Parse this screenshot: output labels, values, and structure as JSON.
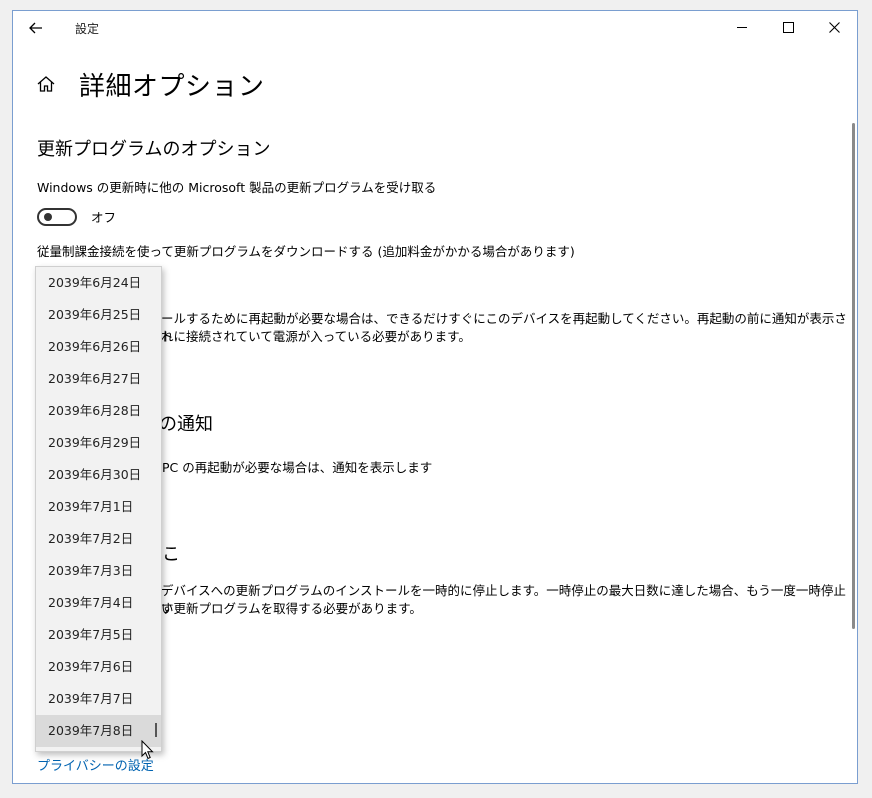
{
  "window": {
    "app_title": "設定",
    "page_title": "詳細オプション"
  },
  "update_options": {
    "section_title": "更新プログラムのオプション",
    "other_products_label": "Windows の更新時に他の Microsoft 製品の更新プログラムを受け取る",
    "toggle_state": "オフ",
    "metered_label": "従量制課金接続を使って更新プログラムをダウンロードする (追加料金がかかる場合があります)"
  },
  "restart_section": {
    "desc_line1": "ールするために再起動が必要な場合は、できるだけすぐにこのデバイスを再起動してください。再起動の前に通知が表示され",
    "desc_line2": "トに接続されていて電源が入っている必要があります。"
  },
  "notify_section": {
    "title_fragment": "の通知",
    "desc": "PC の再起動が必要な場合は、通知を表示します"
  },
  "pause_section": {
    "title_fragment": "こ",
    "desc_line1": "デバイスへの更新プログラムのインストールを一時的に停止します。一時停止の最大日数に達した場合、もう一度一時停止す",
    "desc_line2": "い更新プログラムを取得する必要があります。"
  },
  "dropdown": {
    "items": [
      "2039年6月24日",
      "2039年6月25日",
      "2039年6月26日",
      "2039年6月27日",
      "2039年6月28日",
      "2039年6月29日",
      "2039年6月30日",
      "2039年7月1日",
      "2039年7月2日",
      "2039年7月3日",
      "2039年7月4日",
      "2039年7月5日",
      "2039年7月6日",
      "2039年7月7日",
      "2039年7月8日"
    ],
    "selected_index": 14
  },
  "footer": {
    "privacy_link": "プライバシーの設定"
  },
  "colors": {
    "accent_link": "#0063b1",
    "window_border": "#7a9ed0",
    "dropdown_bg": "#f2f2f2",
    "selected_bg": "#dadada"
  }
}
